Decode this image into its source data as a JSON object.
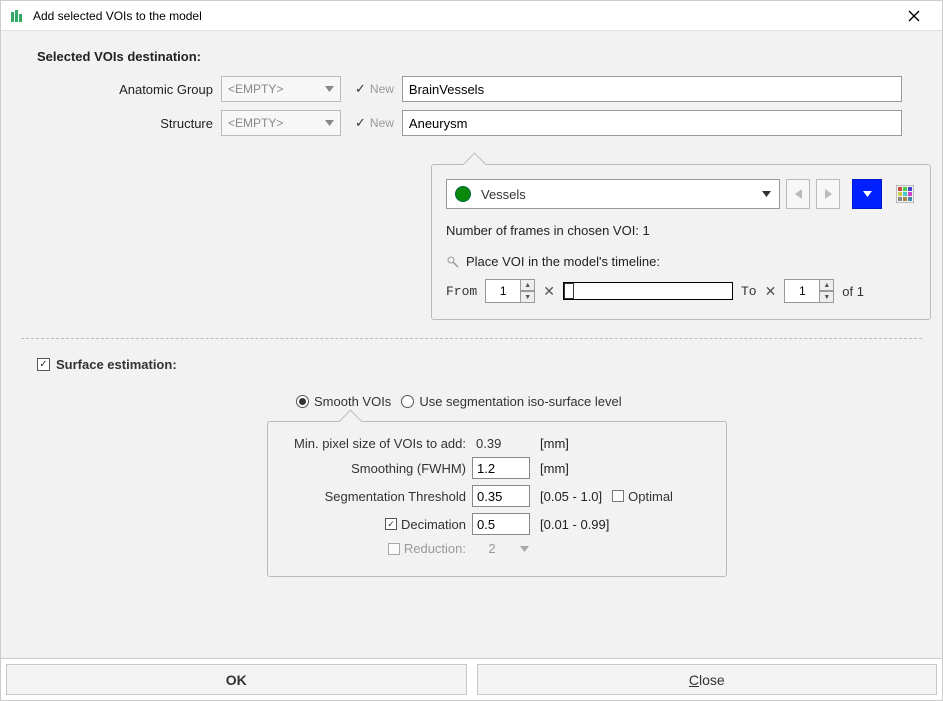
{
  "window": {
    "title": "Add selected VOIs to the model"
  },
  "section1": {
    "heading": "Selected VOIs destination:",
    "anatomic_group_label": "Anatomic Group",
    "structure_label": "Structure",
    "empty_placeholder": "<EMPTY>",
    "new_label": "New",
    "anatomic_group_value": "BrainVessels",
    "structure_value": "Aneurysm"
  },
  "voi_panel": {
    "selected_voi": "Vessels",
    "frames_text": "Number of frames in chosen VOI: 1",
    "timeline_label": "Place VOI in the model's timeline:",
    "from_label": "From",
    "from_value": "1",
    "to_label": "To",
    "to_value": "1",
    "of_label": "of 1"
  },
  "surface": {
    "heading": "Surface estimation:",
    "radio_smooth": "Smooth VOIs",
    "radio_iso": "Use segmentation iso-surface level",
    "min_pixel_label": "Min. pixel size of VOIs to add:",
    "min_pixel_value": "0.39",
    "mm_unit": "[mm]",
    "smoothing_label": "Smoothing (FWHM)",
    "smoothing_value": "1.2",
    "seg_threshold_label": "Segmentation Threshold",
    "seg_threshold_value": "0.35",
    "seg_threshold_range": "[0.05 - 1.0]",
    "optimal_label": "Optimal",
    "decimation_label": "Decimation",
    "decimation_value": "0.5",
    "decimation_range": "[0.01 - 0.99]",
    "reduction_label": "Reduction:",
    "reduction_value": "2"
  },
  "footer": {
    "ok": "OK",
    "close": "Close"
  }
}
